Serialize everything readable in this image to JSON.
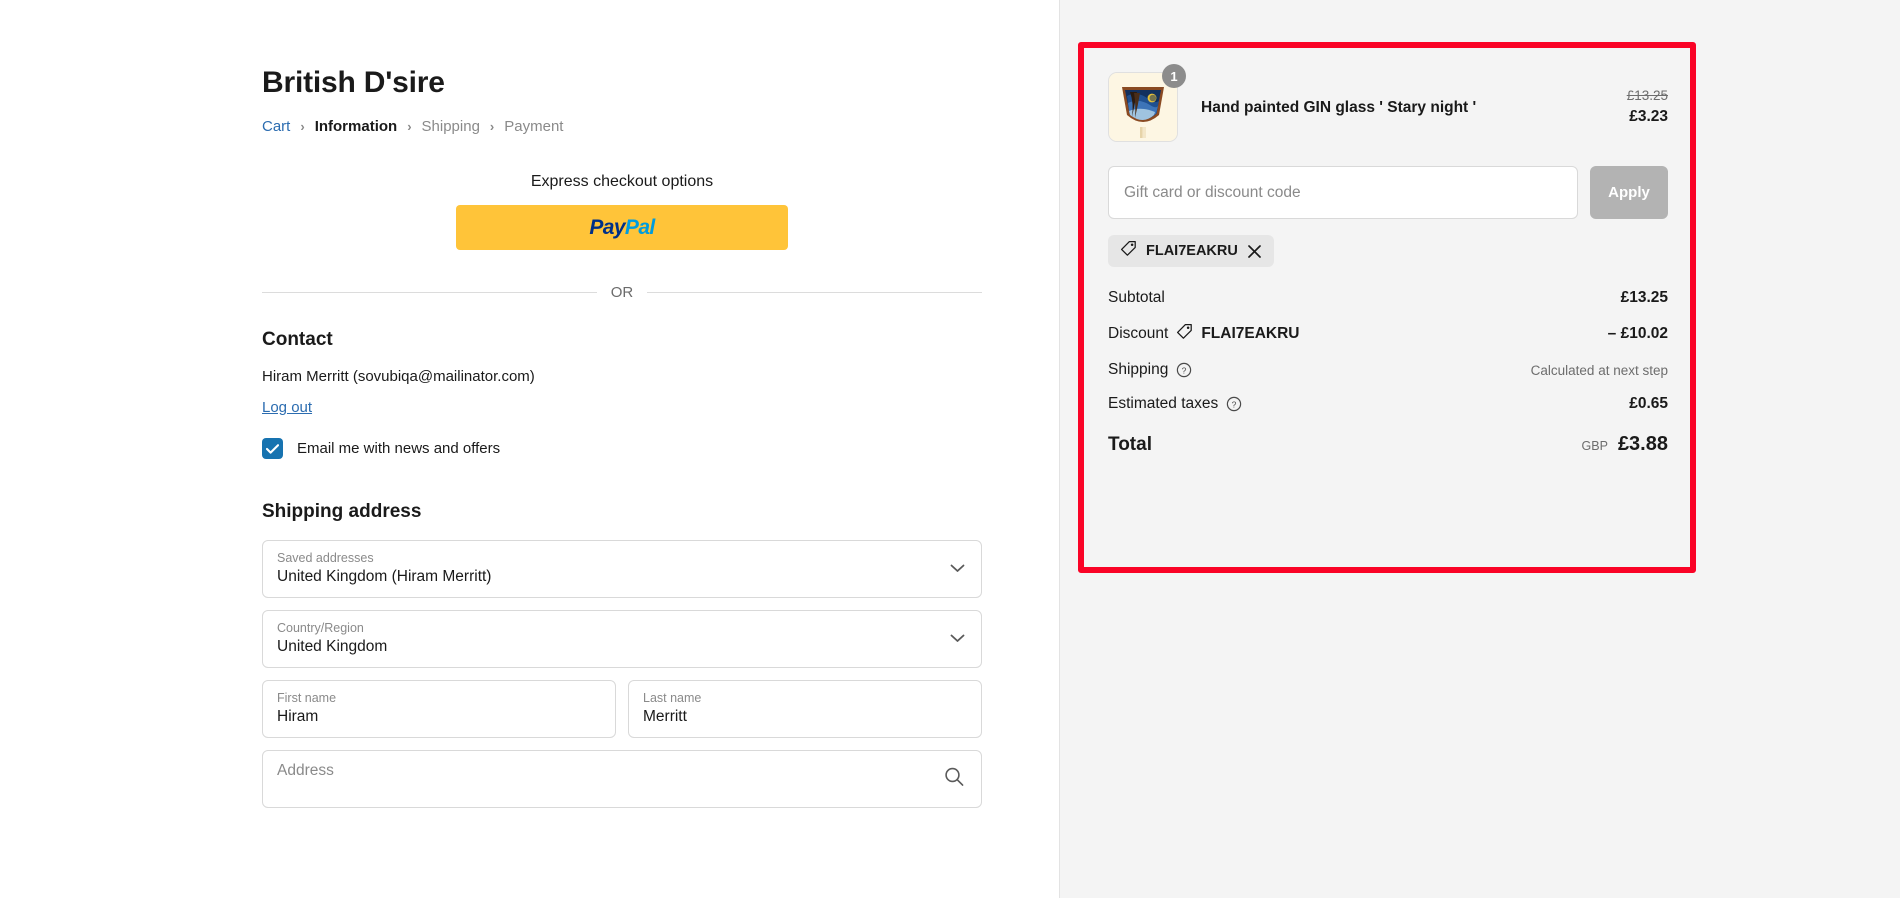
{
  "shop": {
    "title": "British D'sire"
  },
  "breadcrumb": {
    "cart": "Cart",
    "information": "Information",
    "shipping": "Shipping",
    "payment": "Payment",
    "separator": "›"
  },
  "express": {
    "title": "Express checkout options",
    "paypal_pay": "Pay",
    "paypal_pal": "Pal",
    "paypal_button_name": "paypal-express-checkout"
  },
  "divider": {
    "or": "OR"
  },
  "contact": {
    "heading": "Contact",
    "identity": "Hiram Merritt (sovubiqa@mailinator.com)",
    "logout": "Log out",
    "newsletter_label": "Email me with news and offers",
    "newsletter_checked": true
  },
  "shipping_address": {
    "heading": "Shipping address",
    "saved_addresses": {
      "label": "Saved addresses",
      "value": "United Kingdom (Hiram Merritt)"
    },
    "country": {
      "label": "Country/Region",
      "value": "United Kingdom"
    },
    "first_name": {
      "label": "First name",
      "value": "Hiram"
    },
    "last_name": {
      "label": "Last name",
      "value": "Merritt"
    },
    "address": {
      "placeholder": "Address",
      "value": ""
    }
  },
  "order_summary": {
    "item": {
      "title": "Hand painted GIN glass ' Stary night '",
      "quantity": "1",
      "price_original": "£13.25",
      "price_current": "£3.23"
    },
    "discount_field": {
      "placeholder": "Gift card or discount code",
      "value": "",
      "apply_label": "Apply"
    },
    "applied_code": "FLAI7EAKRU",
    "lines": [
      {
        "label": "Subtotal",
        "value": "£13.25",
        "muted": false,
        "code": "",
        "info": false
      },
      {
        "label": "Discount",
        "value": "– £10.02",
        "muted": false,
        "code": "FLAI7EAKRU",
        "info": false
      },
      {
        "label": "Shipping",
        "value": "Calculated at next step",
        "muted": true,
        "code": "",
        "info": true
      },
      {
        "label": "Estimated taxes",
        "value": "£0.65",
        "muted": false,
        "code": "",
        "info": true
      }
    ],
    "total": {
      "label": "Total",
      "currency": "GBP",
      "amount": "£3.88"
    }
  },
  "colors": {
    "accent_blue": "#2b6cb0",
    "checkbox_blue": "#1773b0",
    "paypal_yellow": "#ffc439",
    "paypal_navy": "#003087",
    "paypal_cyan": "#009cde",
    "annotation_red": "#fa0326",
    "panel_bg": "#f4f4f4",
    "apply_disabled": "#b3b3b3"
  }
}
